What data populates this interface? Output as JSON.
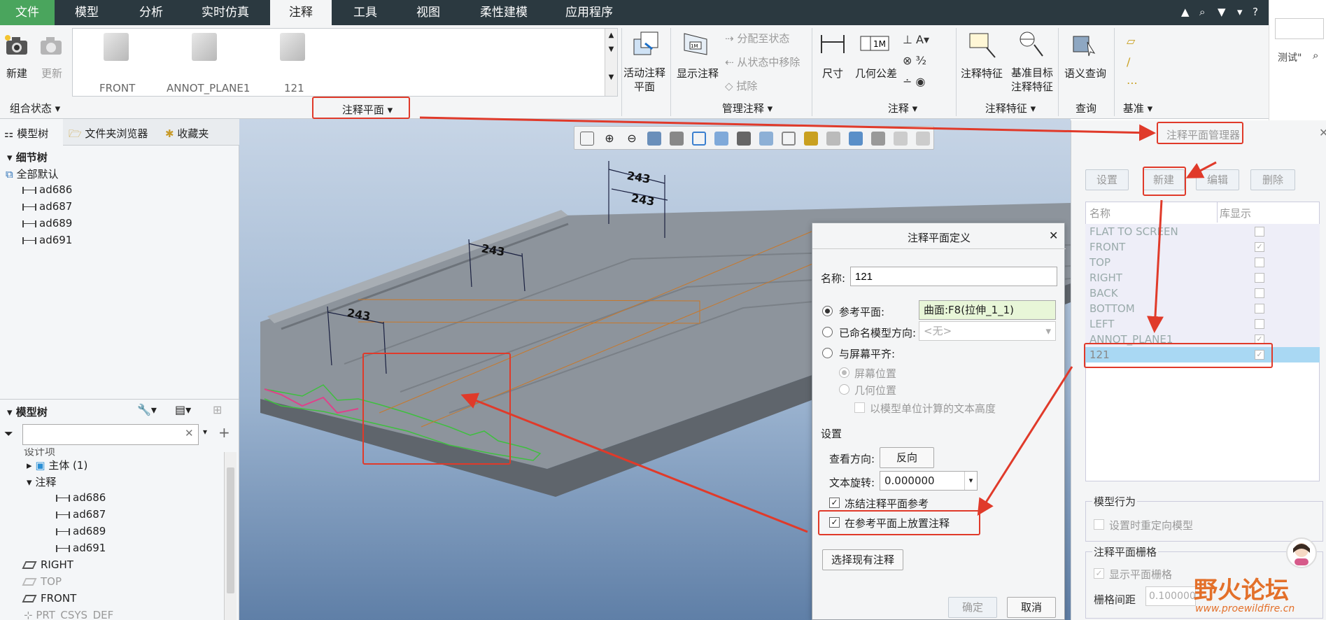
{
  "ribbon_tabs": [
    "文件",
    "模型",
    "分析",
    "实时仿真",
    "注释",
    "工具",
    "视图",
    "柔性建模",
    "应用程序"
  ],
  "ribbon": {
    "new_label": "新建",
    "update_label": "更新",
    "combo_state_label": "组合状态",
    "gallery_items": [
      "FRONT",
      "ANNOT_PLANE1",
      "121"
    ],
    "annot_plane_label": "注释平面",
    "active_plane_label": "活动注释平面",
    "show_annot_label": "显示注释",
    "assign_state_label": "分配至状态",
    "remove_state_label": "从状态中移除",
    "erase_label": "拭除",
    "manage_annot_label": "管理注释",
    "dimension_label": "尺寸",
    "gtol_label": "几何公差",
    "annotation_group_label": "注释",
    "annot_feature_label": "注释特征",
    "datum_target_label": "基准目标注释特征",
    "annot_feature_group_label": "注释特征",
    "semantic_query_label": "语义查询",
    "query_group_label": "查询",
    "datum_group_label": "基准"
  },
  "left_panel": {
    "tab_model_tree": "模型树",
    "tab_folder_browser": "文件夹浏览器",
    "tab_favorites": "收藏夹",
    "detail_tree_title": "细节树",
    "all_default": "全部默认",
    "detail_items": [
      "ad686",
      "ad687",
      "ad689",
      "ad691"
    ],
    "model_tree_title": "模型树",
    "search_placeholder": "",
    "partial_row": "设计项",
    "body_label": "主体 (1)",
    "annotation_label": "注释",
    "annotation_items": [
      "ad686",
      "ad687",
      "ad689",
      "ad691"
    ],
    "planes": [
      "RIGHT",
      "TOP",
      "FRONT"
    ],
    "csys_label": "PRT_CSYS_DEF"
  },
  "viewport": {
    "dimension_labels": [
      "243",
      "243",
      "243",
      "243"
    ]
  },
  "dialog": {
    "title": "注释平面定义",
    "name_label": "名称:",
    "name_value": "121",
    "ref_plane_label": "参考平面:",
    "ref_plane_value": "曲面:F8(拉伸_1_1)",
    "named_view_label": "已命名模型方向:",
    "named_view_value": "<无>",
    "flat_screen_label": "与屏幕平齐:",
    "screen_pos_label": "屏幕位置",
    "geom_pos_label": "几何位置",
    "model_units_label": "以模型单位计算的文本高度",
    "settings_label": "设置",
    "view_dir_label": "查看方向:",
    "flip_label": "反向",
    "text_rot_label": "文本旋转:",
    "text_rot_value": "0.000000",
    "freeze_label": "冻结注释平面参考",
    "place_on_ref_label": "在参考平面上放置注释",
    "select_existing_label": "选择现有注释",
    "ok_label": "确定",
    "cancel_label": "取消"
  },
  "manager": {
    "title": "注释平面管理器",
    "set_label": "设置",
    "new_label": "新建",
    "edit_label": "编辑",
    "delete_label": "删除",
    "col_name": "名称",
    "col_lib": "库显示",
    "rows": [
      {
        "name": "FLAT TO SCREEN",
        "checked": false
      },
      {
        "name": "FRONT",
        "checked": true
      },
      {
        "name": "TOP",
        "checked": false
      },
      {
        "name": "RIGHT",
        "checked": false
      },
      {
        "name": "BACK",
        "checked": false
      },
      {
        "name": "BOTTOM",
        "checked": false
      },
      {
        "name": "LEFT",
        "checked": false
      },
      {
        "name": "ANNOT_PLANE1",
        "checked": true
      },
      {
        "name": "121",
        "checked": true
      }
    ],
    "model_behavior_label": "模型行为",
    "reorient_label": "设置时重定向模型",
    "grid_section_label": "注释平面栅格",
    "show_grid_label": "显示平面栅格",
    "grid_spacing_label": "栅格间距",
    "grid_spacing_value": "0.100000"
  },
  "right_fragment": {
    "text": "测试\""
  },
  "watermark": {
    "brand": "野火论坛",
    "url": "www.proewildfire.cn"
  }
}
